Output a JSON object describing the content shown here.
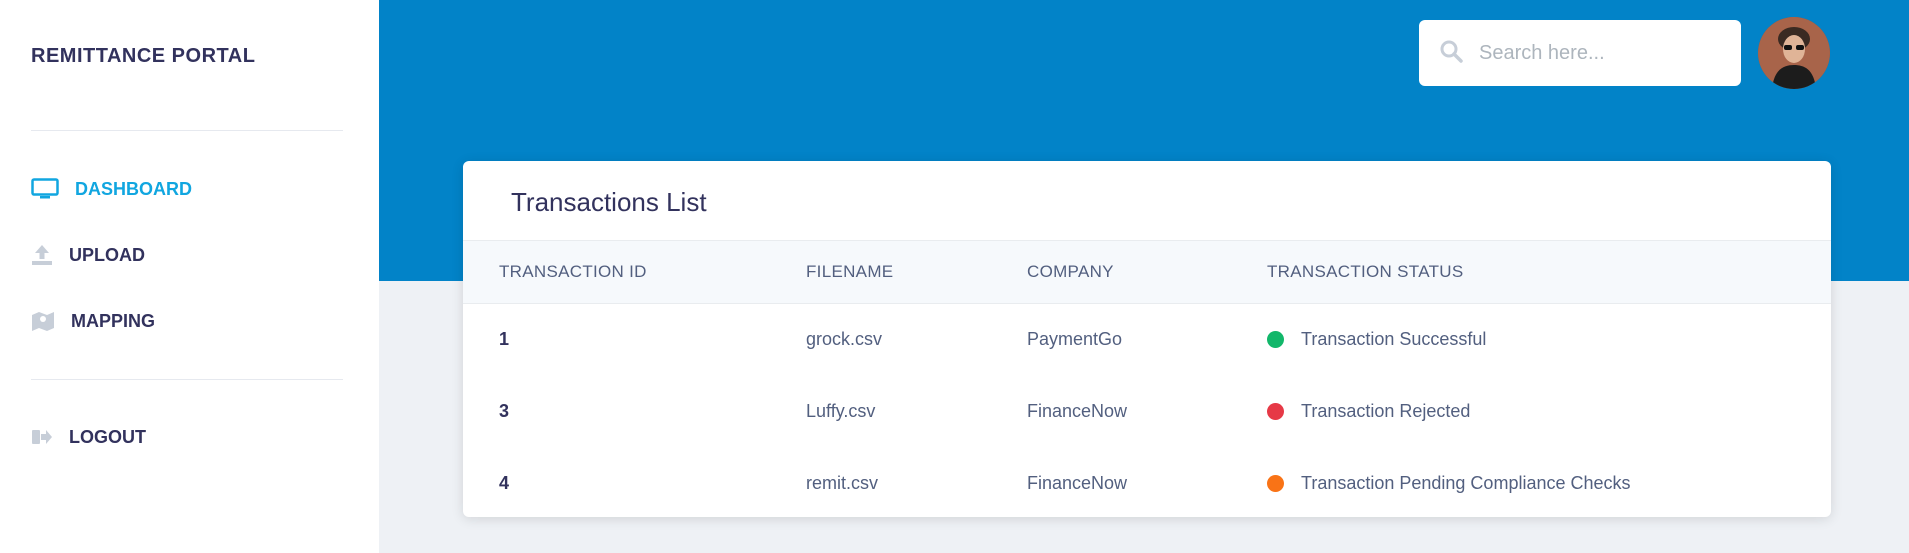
{
  "sidebar": {
    "brand": "REMITTANCE PORTAL",
    "items": [
      {
        "label": "DASHBOARD",
        "icon": "monitor-icon",
        "active": true
      },
      {
        "label": "UPLOAD",
        "icon": "upload-icon"
      },
      {
        "label": "MAPPING",
        "icon": "map-icon"
      }
    ],
    "logout": {
      "label": "LOGOUT",
      "icon": "logout-icon"
    }
  },
  "header": {
    "search_placeholder": "Search here...",
    "search_value": "",
    "avatar": "user-avatar"
  },
  "card": {
    "title": "Transactions List",
    "columns": [
      "TRANSACTION ID",
      "FILENAME",
      "COMPANY",
      "TRANSACTION STATUS"
    ],
    "rows": [
      {
        "id": "1",
        "filename": "grock.csv",
        "company": "PaymentGo",
        "status": "Transaction Successful",
        "status_color": "#12b76a"
      },
      {
        "id": "3",
        "filename": "Luffy.csv",
        "company": "FinanceNow",
        "status": "Transaction Rejected",
        "status_color": "#e63946"
      },
      {
        "id": "4",
        "filename": "remit.csv",
        "company": "FinanceNow",
        "status": "Transaction Pending Compliance Checks",
        "status_color": "#f97316"
      }
    ]
  },
  "colors": {
    "accent": "#11a6e0",
    "header_bg": "#0283c8",
    "text_dark": "#32325d"
  }
}
